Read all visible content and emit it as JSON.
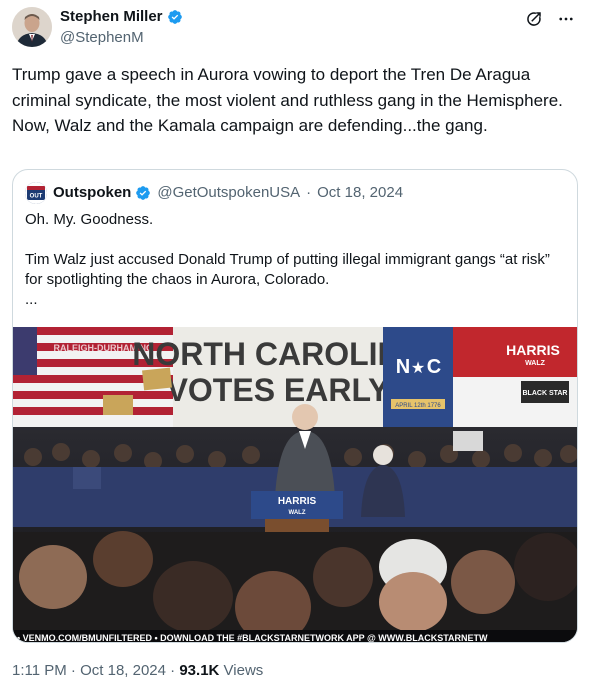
{
  "author": {
    "name": "Stephen Miller",
    "handle": "@StephenM",
    "colors": {
      "verified": "#1d9bf0"
    }
  },
  "tweet": {
    "text": "Trump gave a speech in Aurora vowing to deport the Tren De Aragua criminal syndicate, the most violent and ruthless gang in the Hemisphere. Now, Walz and the Kamala campaign are defending...the gang."
  },
  "quote": {
    "name": "Outspoken",
    "handle": "@GetOutspokenUSA",
    "separator": "·",
    "date": "Oct 18, 2024",
    "line1": "Oh. My. Goodness.",
    "line2": "Tim Walz just accused Donald Trump of putting illegal immigrant gangs “at risk” for spotlighting the chaos in Aurora, Colorado.",
    "line3": "...",
    "media": {
      "banner_line1": "NORTH CAROLINA",
      "banner_line2": "VOTES EARLY",
      "nc_left": "N",
      "nc_star": "★",
      "nc_right": "C",
      "nc_ribbon": "APRIL 12th 1776",
      "harris_top": "HARRIS",
      "harris_sub": "WALZ",
      "black_star": "BLACK STAR",
      "podium_top": "HARRIS",
      "podium_sub": "WALZ",
      "flag_text": "RALEIGH-DURHAM NC",
      "ticker": "• VENMO.COM/BMUNFILTERED • DOWNLOAD THE #BLACKSTARNETWORK APP @ WWW.BLACKSTARNETW"
    }
  },
  "footer": {
    "time": "1:11 PM",
    "sep1": "·",
    "date": "Oct 18, 2024",
    "sep2": "·",
    "views_count": "93.1K",
    "views_label": "Views"
  },
  "icons": {
    "verified": "verified-badge-icon",
    "grok": "grok-icon",
    "more": "more-icon"
  }
}
